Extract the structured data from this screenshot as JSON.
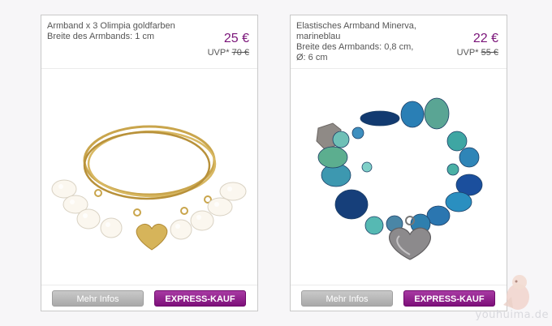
{
  "products": [
    {
      "title": "Armband x 3 Olimpia goldfarben",
      "width": "Breite des Armbands: 1 cm",
      "extra": "",
      "price": "25 €",
      "uvp_label": "UVP*",
      "uvp_old": "70 €",
      "info_label": "Mehr Infos",
      "express_label": "EXPRESS-KAUF"
    },
    {
      "title": "Elastisches Armband Minerva, marineblau",
      "width": "Breite des Armbands: 0,8 cm,",
      "extra": "Ø: 6 cm",
      "price": "22 €",
      "uvp_label": "UVP*",
      "uvp_old": "55 €",
      "info_label": "Mehr Infos",
      "express_label": "EXPRESS-KAUF"
    }
  ],
  "watermark": "youhuima.de",
  "colors": {
    "price": "#7a1479",
    "express": "#8b1a88"
  }
}
